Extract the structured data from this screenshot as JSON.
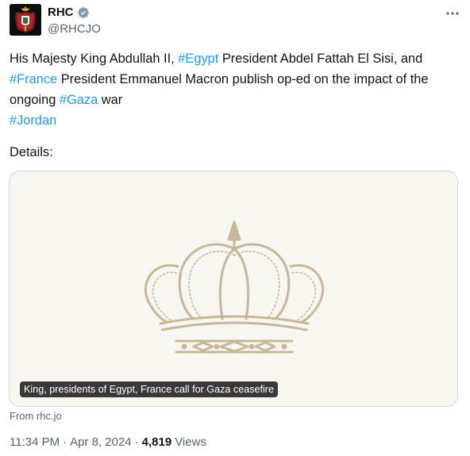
{
  "author": {
    "name": "RHC",
    "handle": "@RHCJO",
    "verified_color": "#829aab",
    "avatar_icon": "royal-crest-icon"
  },
  "more_icon": "more-options-icon",
  "tweet": {
    "segments": [
      {
        "text": "His Majesty King Abdullah II, ",
        "type": "text"
      },
      {
        "text": "#Egypt",
        "type": "hashtag"
      },
      {
        "text": " President Abdel Fattah El Sisi, and ",
        "type": "text"
      },
      {
        "text": "#France",
        "type": "hashtag"
      },
      {
        "text": " President Emmanuel Macron publish op-ed on the impact of the ongoing ",
        "type": "text"
      },
      {
        "text": "#Gaza",
        "type": "hashtag"
      },
      {
        "text": " war",
        "type": "text"
      },
      {
        "text": "#Jordan",
        "type": "hashtag"
      }
    ],
    "details": "Details:"
  },
  "card": {
    "caption": "King, presidents of Egypt, France call for Gaza ceasefire",
    "image_icon": "jordan-crown-icon",
    "background": "#f8f6f0",
    "crown_color": "#c8b89a",
    "source": "From rhc.jo"
  },
  "meta": {
    "time": "11:34 PM",
    "separator": "·",
    "date": "Apr 8, 2024",
    "views_count": "4,819",
    "views_label": "Views"
  },
  "colors": {
    "hashtag": "#1d9bf0",
    "secondary_text": "#536471",
    "primary_text": "#0f1419",
    "border": "#cfd9de"
  }
}
